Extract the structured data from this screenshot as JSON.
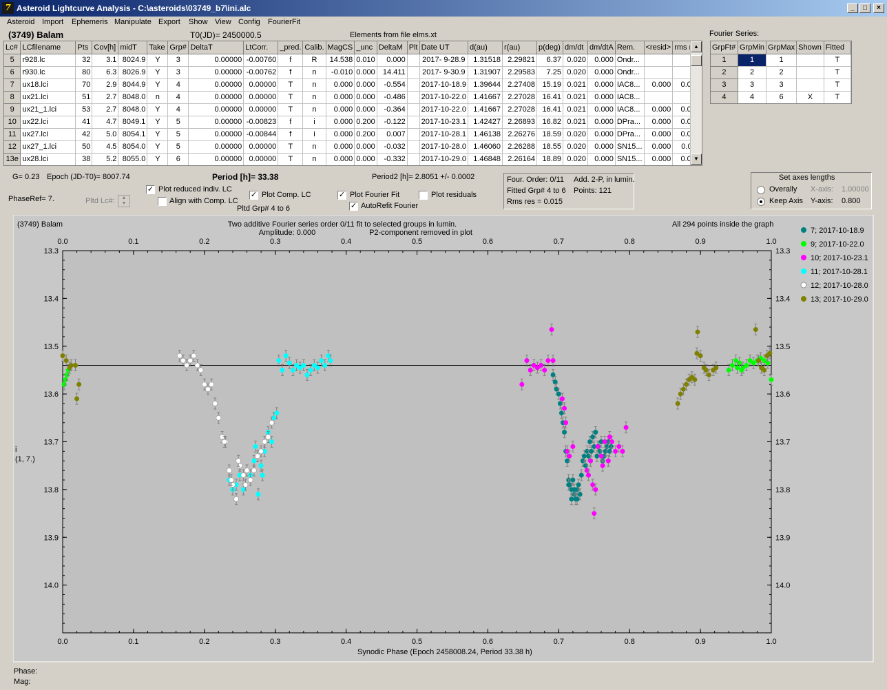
{
  "window": {
    "title": "Asteroid Lightcurve Analysis - C:\\asteroids\\03749_b7\\ini.alc",
    "icon": "7"
  },
  "menu": [
    "Asteroid",
    "Import",
    "Ephemeris",
    "Manipulate",
    "Export",
    "Show",
    "View",
    "Config",
    "FourierFit"
  ],
  "header": {
    "asteroid": "(3749) Balam",
    "t0": "T0(JD)= 2450000.5",
    "elements": "Elements from file elms.xt",
    "fourier_series_label": "Fourier Series:"
  },
  "lc_table": {
    "columns": [
      "Lc#",
      "LCfilename",
      "Pts",
      "Cov[h]",
      "midT",
      "Take",
      "Grp#",
      "DeltaT",
      "LtCorr.",
      "_pred.",
      "Calib.",
      "MagCS",
      "_unc",
      "DeltaM",
      "Plt",
      "Date UT",
      "d(au)",
      "r(au)",
      "p(deg)",
      "dm/dt",
      "dm/dtA",
      "Rem.",
      "<resid>",
      "rms res"
    ],
    "rows": [
      [
        "5",
        "r928.lc",
        "32",
        "3.1",
        "8024.9",
        "Y",
        "3",
        "0.00000",
        "-0.00760",
        "f",
        "R",
        "14.538",
        "0.010",
        "0.000",
        "",
        "2017- 9-28.9",
        "1.31518",
        "2.29821",
        "6.37",
        "0.020",
        "0.000",
        "Ondr...",
        "",
        ""
      ],
      [
        "6",
        "r930.lc",
        "80",
        "6.3",
        "8026.9",
        "Y",
        "3",
        "0.00000",
        "-0.00762",
        "f",
        "n",
        "-0.010",
        "0.000",
        "14.411",
        "",
        "2017- 9-30.9",
        "1.31907",
        "2.29583",
        "7.25",
        "0.020",
        "0.000",
        "Ondr...",
        "",
        ""
      ],
      [
        "7",
        "ux18.lci",
        "70",
        "2.9",
        "8044.9",
        "Y",
        "4",
        "0.00000",
        "0.00000",
        "T",
        "n",
        "0.000",
        "0.000",
        "-0.554",
        "",
        "2017-10-18.9",
        "1.39644",
        "2.27408",
        "15.19",
        "0.021",
        "0.000",
        "IAC8...",
        "0.000",
        "0.006"
      ],
      [
        "8",
        "ux21.lci",
        "51",
        "2.7",
        "8048.0",
        "n",
        "4",
        "0.00000",
        "0.00000",
        "T",
        "n",
        "0.000",
        "0.000",
        "-0.486",
        "",
        "2017-10-22.0",
        "1.41667",
        "2.27028",
        "16.41",
        "0.021",
        "0.000",
        "IAC8...",
        "",
        ""
      ],
      [
        "9",
        "ux21_1.lci",
        "53",
        "2.7",
        "8048.0",
        "Y",
        "4",
        "0.00000",
        "0.00000",
        "T",
        "n",
        "0.000",
        "0.000",
        "-0.364",
        "",
        "2017-10-22.0",
        "1.41667",
        "2.27028",
        "16.41",
        "0.021",
        "0.000",
        "IAC8...",
        "0.000",
        "0.014"
      ],
      [
        "10",
        "ux22.lci",
        "41",
        "4.7",
        "8049.1",
        "Y",
        "5",
        "0.00000",
        "-0.00823",
        "f",
        "i",
        "0.000",
        "0.200",
        "-0.122",
        "",
        "2017-10-23.1",
        "1.42427",
        "2.26893",
        "16.82",
        "0.021",
        "0.000",
        "DPra...",
        "0.000",
        "0.009"
      ],
      [
        "11",
        "ux27.lci",
        "42",
        "5.0",
        "8054.1",
        "Y",
        "5",
        "0.00000",
        "-0.00844",
        "f",
        "i",
        "0.000",
        "0.200",
        "0.007",
        "",
        "2017-10-28.1",
        "1.46138",
        "2.26276",
        "18.59",
        "0.020",
        "0.000",
        "DPra...",
        "0.000",
        "0.012"
      ],
      [
        "12",
        "ux27_1.lci",
        "50",
        "4.5",
        "8054.0",
        "Y",
        "5",
        "0.00000",
        "0.00000",
        "T",
        "n",
        "0.000",
        "0.000",
        "-0.032",
        "",
        "2017-10-28.0",
        "1.46060",
        "2.26288",
        "18.55",
        "0.020",
        "0.000",
        "SN15...",
        "0.000",
        "0.011"
      ],
      [
        "13e",
        "ux28.lci",
        "38",
        "5.2",
        "8055.0",
        "Y",
        "6",
        "0.00000",
        "0.00000",
        "T",
        "n",
        "0.000",
        "0.000",
        "-0.332",
        "",
        "2017-10-29.0",
        "1.46848",
        "2.26164",
        "18.89",
        "0.020",
        "0.000",
        "SN15...",
        "0.000",
        "0.015"
      ]
    ]
  },
  "fourier_table": {
    "columns": [
      "GrpFt#",
      "GrpMin",
      "GrpMax",
      "Shown",
      "Fitted"
    ],
    "rows": [
      [
        "1",
        "1",
        "1",
        "",
        "T"
      ],
      [
        "2",
        "2",
        "2",
        "",
        "T"
      ],
      [
        "3",
        "3",
        "3",
        "",
        "T"
      ],
      [
        "4",
        "4",
        "6",
        "X",
        "T"
      ]
    ]
  },
  "info": {
    "g": "G= 0.23",
    "epoch": "Epoch (JD-T0)= 8007.74",
    "period": "Period [h]= 33.38",
    "period2": "Period2 [h]= 2.8051 +/- 0.0002",
    "phase_ref": "PhaseRef= 7.",
    "pltd_lc": "Pltd Lc#:",
    "pltd_grp": "Pltd Grp#  4   to    6",
    "four_order": "Four. Order:  0/11",
    "add_2p": "Add. 2-P, in lumin.",
    "fitted_grp": "Fitted Grp# 4 to 6",
    "points": "Points: 121",
    "rms": "Rms res      = 0.015"
  },
  "checkboxes": {
    "plot_reduced": {
      "label": "Plot reduced indiv. LC",
      "checked": true
    },
    "align_comp": {
      "label": "Align with Comp. LC",
      "checked": false
    },
    "plot_comp": {
      "label": "Plot Comp. LC",
      "checked": true
    },
    "plot_fourier": {
      "label": "Plot Fourier Fit",
      "checked": true
    },
    "plot_residuals": {
      "label": "Plot residuals",
      "checked": false
    },
    "autorefit": {
      "label": "AutoRefit Fourier",
      "checked": true
    }
  },
  "axes_box": {
    "title": "Set axes lengths",
    "overally": "Overally",
    "keep_axis": "Keep Axis",
    "x_axis_label": "X-axis:",
    "x_axis_value": "1.00000",
    "y_axis_label": "Y-axis:",
    "y_axis_value": "0.800"
  },
  "status": {
    "phase": "Phase:",
    "mag": "Mag:"
  },
  "chart_data": {
    "type": "scatter",
    "title": "(3749) Balam",
    "subtitle1": "Two additive Fourier series order 0/11 fit to selected groups in lumin.",
    "subtitle2": "Amplitude: 0.000",
    "subtitle3": "P2-component removed in plot",
    "note": "All 294 points inside the graph",
    "xlabel": "Synodic Phase (Epoch 2458008.24, Period 33.38 h)",
    "ylabel": "i",
    "ylabel2": "(1, 7.)",
    "xlim": [
      0,
      1
    ],
    "ylim": [
      13.3,
      14.1
    ],
    "y_inverted": true,
    "x_ticks": [
      "0.0",
      "0.1",
      "0.2",
      "0.3",
      "0.4",
      "0.5",
      "0.6",
      "0.7",
      "0.8",
      "0.9",
      "1.0"
    ],
    "y_ticks": [
      "13.3",
      "13.4",
      "13.5",
      "13.6",
      "13.7",
      "13.8",
      "13.9",
      "14.0"
    ],
    "fit_line_y": 13.54,
    "series": [
      {
        "name": "7; 2017-10-18.9",
        "color": "#008080",
        "points": [
          [
            0.692,
            13.56
          ],
          [
            0.695,
            13.575
          ],
          [
            0.697,
            13.59
          ],
          [
            0.7,
            13.6
          ],
          [
            0.702,
            13.62
          ],
          [
            0.704,
            13.64
          ],
          [
            0.706,
            13.66
          ],
          [
            0.708,
            13.68
          ],
          [
            0.71,
            13.72
          ],
          [
            0.712,
            13.74
          ],
          [
            0.714,
            13.78
          ],
          [
            0.716,
            13.79
          ],
          [
            0.718,
            13.8
          ],
          [
            0.72,
            13.78
          ],
          [
            0.722,
            13.81
          ],
          [
            0.724,
            13.82
          ],
          [
            0.726,
            13.8
          ],
          [
            0.728,
            13.79
          ],
          [
            0.73,
            13.81
          ],
          [
            0.732,
            13.77
          ],
          [
            0.734,
            13.74
          ],
          [
            0.736,
            13.73
          ],
          [
            0.738,
            13.75
          ],
          [
            0.74,
            13.72
          ],
          [
            0.742,
            13.73
          ],
          [
            0.744,
            13.7
          ],
          [
            0.746,
            13.72
          ],
          [
            0.748,
            13.69
          ],
          [
            0.75,
            13.71
          ],
          [
            0.752,
            13.68
          ],
          [
            0.754,
            13.73
          ],
          [
            0.756,
            13.71
          ],
          [
            0.758,
            13.72
          ],
          [
            0.76,
            13.7
          ],
          [
            0.762,
            13.74
          ],
          [
            0.764,
            13.73
          ],
          [
            0.766,
            13.72
          ],
          [
            0.768,
            13.71
          ],
          [
            0.77,
            13.7
          ],
          [
            0.772,
            13.72
          ],
          [
            0.774,
            13.71
          ],
          [
            0.714,
            13.79
          ],
          [
            0.718,
            13.82
          ],
          [
            0.722,
            13.8
          ],
          [
            0.726,
            13.82
          ]
        ]
      },
      {
        "name": "9; 2017-10-22.0",
        "color": "#00ff00",
        "points": [
          [
            0.002,
            13.58
          ],
          [
            0.004,
            13.57
          ],
          [
            0.006,
            13.56
          ],
          [
            0.008,
            13.55
          ],
          [
            0.94,
            13.55
          ],
          [
            0.945,
            13.54
          ],
          [
            0.95,
            13.53
          ],
          [
            0.955,
            13.535
          ],
          [
            0.96,
            13.545
          ],
          [
            0.965,
            13.54
          ],
          [
            0.97,
            13.53
          ],
          [
            0.975,
            13.535
          ],
          [
            0.98,
            13.53
          ],
          [
            0.985,
            13.525
          ],
          [
            0.99,
            13.53
          ],
          [
            0.995,
            13.535
          ],
          [
            1.0,
            13.57
          ],
          [
            0.958,
            13.55
          ],
          [
            0.952,
            13.545
          ]
        ]
      },
      {
        "name": "10; 2017-10-23.1",
        "color": "#ff00ff",
        "points": [
          [
            0.648,
            13.58
          ],
          [
            0.655,
            13.53
          ],
          [
            0.66,
            13.55
          ],
          [
            0.665,
            13.54
          ],
          [
            0.67,
            13.545
          ],
          [
            0.675,
            13.54
          ],
          [
            0.68,
            13.55
          ],
          [
            0.685,
            13.53
          ],
          [
            0.69,
            13.465
          ],
          [
            0.692,
            13.53
          ],
          [
            0.705,
            13.61
          ],
          [
            0.708,
            13.63
          ],
          [
            0.71,
            13.66
          ],
          [
            0.712,
            13.72
          ],
          [
            0.715,
            13.73
          ],
          [
            0.72,
            13.71
          ],
          [
            0.74,
            13.76
          ],
          [
            0.745,
            13.74
          ],
          [
            0.748,
            13.79
          ],
          [
            0.75,
            13.85
          ],
          [
            0.752,
            13.8
          ],
          [
            0.755,
            13.71
          ],
          [
            0.76,
            13.73
          ],
          [
            0.765,
            13.7
          ],
          [
            0.77,
            13.74
          ],
          [
            0.775,
            13.7
          ],
          [
            0.78,
            13.72
          ],
          [
            0.785,
            13.71
          ],
          [
            0.79,
            13.72
          ],
          [
            0.795,
            13.67
          ],
          [
            0.772,
            13.69
          ],
          [
            0.762,
            13.75
          ],
          [
            0.742,
            13.77
          ]
        ]
      },
      {
        "name": "11; 2017-10-28.1",
        "color": "#00ffff",
        "points": [
          [
            0.305,
            13.53
          ],
          [
            0.31,
            13.55
          ],
          [
            0.315,
            13.52
          ],
          [
            0.32,
            13.535
          ],
          [
            0.325,
            13.55
          ],
          [
            0.33,
            13.54
          ],
          [
            0.335,
            13.545
          ],
          [
            0.34,
            13.54
          ],
          [
            0.345,
            13.56
          ],
          [
            0.35,
            13.55
          ],
          [
            0.355,
            13.54
          ],
          [
            0.36,
            13.545
          ],
          [
            0.365,
            13.53
          ],
          [
            0.37,
            13.54
          ],
          [
            0.375,
            13.52
          ],
          [
            0.378,
            13.53
          ],
          [
            0.235,
            13.78
          ],
          [
            0.24,
            13.8
          ],
          [
            0.245,
            13.79
          ],
          [
            0.25,
            13.77
          ],
          [
            0.255,
            13.8
          ],
          [
            0.26,
            13.76
          ],
          [
            0.265,
            13.77
          ],
          [
            0.27,
            13.74
          ],
          [
            0.272,
            13.71
          ],
          [
            0.276,
            13.81
          ],
          [
            0.28,
            13.75
          ],
          [
            0.282,
            13.77
          ],
          [
            0.285,
            13.72
          ],
          [
            0.29,
            13.68
          ],
          [
            0.295,
            13.7
          ],
          [
            0.298,
            13.65
          ],
          [
            0.302,
            13.64
          ]
        ]
      },
      {
        "name": "12; 2017-10-28.0",
        "color": "#ffffff",
        "points": [
          [
            0.165,
            13.52
          ],
          [
            0.17,
            13.53
          ],
          [
            0.175,
            13.54
          ],
          [
            0.18,
            13.53
          ],
          [
            0.185,
            13.52
          ],
          [
            0.19,
            13.54
          ],
          [
            0.195,
            13.55
          ],
          [
            0.2,
            13.58
          ],
          [
            0.205,
            13.59
          ],
          [
            0.21,
            13.58
          ],
          [
            0.215,
            13.62
          ],
          [
            0.22,
            13.65
          ],
          [
            0.225,
            13.69
          ],
          [
            0.23,
            13.7
          ],
          [
            0.235,
            13.76
          ],
          [
            0.24,
            13.79
          ],
          [
            0.245,
            13.82
          ],
          [
            0.25,
            13.75
          ],
          [
            0.255,
            13.77
          ],
          [
            0.26,
            13.76
          ],
          [
            0.265,
            13.78
          ],
          [
            0.27,
            13.76
          ],
          [
            0.275,
            13.73
          ],
          [
            0.28,
            13.72
          ],
          [
            0.285,
            13.7
          ],
          [
            0.29,
            13.69
          ],
          [
            0.295,
            13.66
          ],
          [
            0.228,
            13.7
          ],
          [
            0.238,
            13.78
          ],
          [
            0.248,
            13.74
          ],
          [
            0.258,
            13.79
          ]
        ]
      },
      {
        "name": "13; 2017-10-29.0",
        "color": "#808000",
        "points": [
          [
            0.0,
            13.52
          ],
          [
            0.005,
            13.53
          ],
          [
            0.01,
            13.545
          ],
          [
            0.012,
            13.54
          ],
          [
            0.018,
            13.54
          ],
          [
            0.02,
            13.61
          ],
          [
            0.023,
            13.58
          ],
          [
            0.868,
            13.62
          ],
          [
            0.872,
            13.6
          ],
          [
            0.876,
            13.59
          ],
          [
            0.88,
            13.58
          ],
          [
            0.884,
            13.57
          ],
          [
            0.888,
            13.565
          ],
          [
            0.892,
            13.57
          ],
          [
            0.895,
            13.515
          ],
          [
            0.9,
            13.52
          ],
          [
            0.905,
            13.545
          ],
          [
            0.908,
            13.55
          ],
          [
            0.912,
            13.56
          ],
          [
            0.918,
            13.55
          ],
          [
            0.922,
            13.545
          ],
          [
            0.896,
            13.47
          ],
          [
            0.978,
            13.465
          ],
          [
            0.982,
            13.53
          ],
          [
            0.986,
            13.545
          ],
          [
            0.99,
            13.55
          ],
          [
            0.994,
            13.52
          ],
          [
            0.998,
            13.515
          ]
        ]
      }
    ]
  }
}
